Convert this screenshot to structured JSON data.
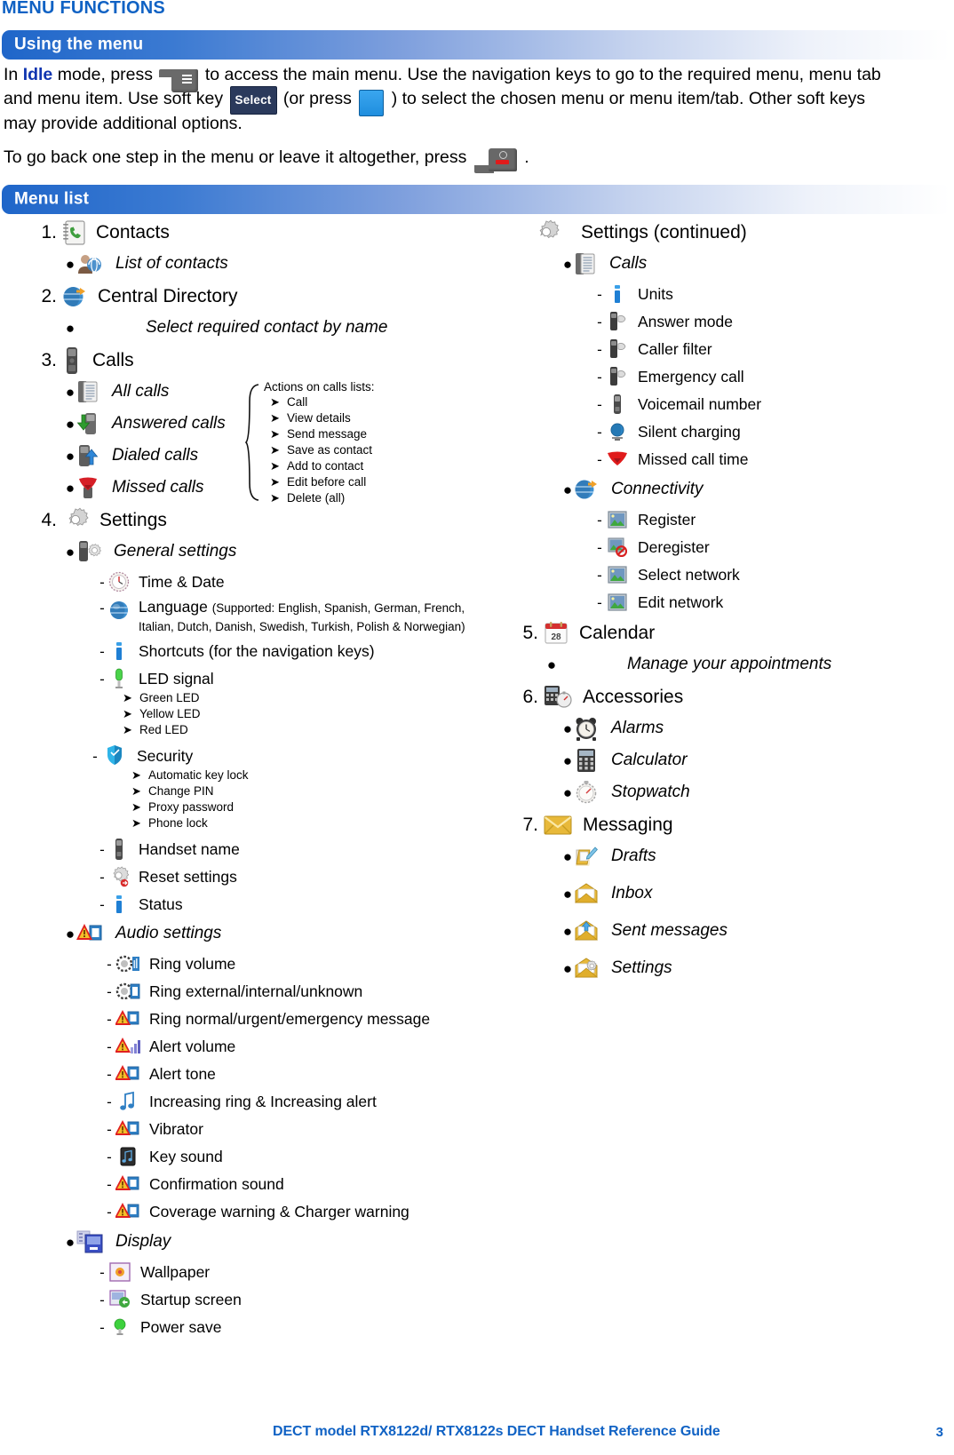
{
  "page": {
    "title": "MENU FUNCTIONS",
    "footer_text": "DECT model RTX8122d/ RTX8122s DECT Handset Reference Guide",
    "footer_page": "3"
  },
  "sections": {
    "using_the_menu": {
      "bar_label": "Using the menu",
      "paragraph1_a": "In ",
      "paragraph1_idle": "Idle",
      "paragraph1_b": " mode, press ",
      "paragraph1_c": " to access the main menu. Use the navigation keys to go to the required menu, menu tab and menu item. Use soft key ",
      "select_key": "Select",
      "paragraph1_d": " (or press ",
      "paragraph1_e": " ) to select the chosen menu or menu item/tab. Other soft keys may provide additional options.",
      "paragraph2_a": "To go back one step in the menu or leave it altogether, press ",
      "paragraph2_b": " ."
    },
    "menu_list": {
      "bar_label": "Menu list"
    }
  },
  "actions_box": {
    "title": "Actions on calls lists:",
    "items": [
      "Call",
      "View details",
      "Send message",
      "Save as contact",
      "Add to contact",
      "Edit before call",
      "Delete (all)"
    ]
  },
  "left_column": {
    "item1": {
      "num": "1.",
      "label": "Contacts",
      "icon": "contacts-book-icon"
    },
    "item1_sub1": {
      "label": "List of contacts",
      "icon": "person-contacts-icon"
    },
    "item2": {
      "num": "2.",
      "label": "Central Directory",
      "icon": "globe-directory-icon"
    },
    "item2_sub1": {
      "label": "Select required contact by name",
      "icon": "none"
    },
    "item3": {
      "num": "3.",
      "label": "Calls",
      "icon": "handset-icon"
    },
    "item3_sub1": {
      "label": "All calls",
      "icon": "call-list-icon"
    },
    "item3_sub2": {
      "label": "Answered calls",
      "icon": "answered-call-icon"
    },
    "item3_sub3": {
      "label": "Dialed calls",
      "icon": "dialed-call-icon"
    },
    "item3_sub4": {
      "label": "Missed calls",
      "icon": "missed-call-icon"
    },
    "item4": {
      "num": "4.",
      "label": "Settings",
      "icon": "gear-icon"
    },
    "general_settings": {
      "label": "General settings",
      "icon": "handset-gear-icon"
    },
    "time_date": {
      "label": "Time & Date",
      "icon": "clock-icon"
    },
    "language": {
      "label": "Language",
      "note": "(Supported: English, Spanish, German, French, Italian, Dutch, Danish, Swedish, Turkish, Polish & Norwegian)",
      "icon": "globe-icon"
    },
    "shortcuts": {
      "label": "Shortcuts (for the navigation keys)",
      "icon": "info-icon"
    },
    "led_signal": {
      "label": "LED signal",
      "icon": "led-icon",
      "items": [
        "Green LED",
        "Yellow LED",
        "Red LED"
      ]
    },
    "security": {
      "label": "Security",
      "icon": "shield-icon",
      "items": [
        "Automatic key lock",
        "Change PIN",
        "Proxy password",
        "Phone lock"
      ]
    },
    "handset_name": {
      "label": "Handset name",
      "icon": "handset-icon"
    },
    "reset_settings": {
      "label": "Reset settings",
      "icon": "gear-reset-icon"
    },
    "status": {
      "label": "Status",
      "icon": "info-icon"
    },
    "audio_settings": {
      "label": "Audio settings",
      "icon": "alert-speaker-icon"
    },
    "audio_items": [
      {
        "label": "Ring volume",
        "icon": "ring-volume-icon"
      },
      {
        "label": "Ring external/internal/unknown",
        "icon": "ring-source-icon"
      },
      {
        "label": "Ring normal/urgent/emergency message",
        "icon": "alert-speaker-icon"
      },
      {
        "label": "Alert volume",
        "icon": "alert-volume-icon"
      },
      {
        "label": "Alert tone",
        "icon": "alert-speaker-icon"
      },
      {
        "label": "Increasing ring & Increasing alert",
        "icon": "music-note-icon"
      },
      {
        "label": "Vibrator",
        "icon": "alert-speaker-icon"
      },
      {
        "label": "Key sound",
        "icon": "key-sound-icon"
      },
      {
        "label": "Confirmation sound",
        "icon": "alert-speaker-icon"
      },
      {
        "label": "Coverage warning & Charger warning",
        "icon": "alert-speaker-icon"
      }
    ],
    "display": {
      "label": "Display",
      "icon": "display-icon"
    },
    "display_items": [
      {
        "label": "Wallpaper",
        "icon": "wallpaper-icon"
      },
      {
        "label": "Startup screen",
        "icon": "startup-screen-icon"
      },
      {
        "label": "Power save",
        "icon": "power-save-icon"
      }
    ]
  },
  "right_column": {
    "settings_continued": {
      "label": "Settings (continued)",
      "icon": "gear-icon"
    },
    "calls": {
      "label": "Calls",
      "icon": "call-list-icon"
    },
    "calls_items": [
      {
        "label": "Units",
        "icon": "info-icon"
      },
      {
        "label": "Answer mode",
        "icon": "handset-answer-icon"
      },
      {
        "label": "Caller filter",
        "icon": "handset-answer-icon"
      },
      {
        "label": "Emergency call",
        "icon": "handset-answer-icon"
      },
      {
        "label": "Voicemail number",
        "icon": "handset-icon"
      },
      {
        "label": "Silent charging",
        "icon": "silent-charging-icon"
      },
      {
        "label": "Missed call time",
        "icon": "missed-call-arrow-icon"
      }
    ],
    "connectivity": {
      "label": "Connectivity",
      "icon": "globe-directory-icon"
    },
    "connectivity_items": [
      {
        "label": "Register",
        "icon": "network-icon"
      },
      {
        "label": "Deregister",
        "icon": "network-deregister-icon"
      },
      {
        "label": "Select network",
        "icon": "network-icon"
      },
      {
        "label": "Edit network",
        "icon": "network-icon"
      }
    ],
    "item5": {
      "num": "5.",
      "label": "Calendar",
      "icon": "calendar-icon",
      "calendar_day": "28"
    },
    "item5_sub1": {
      "label": "Manage your appointments",
      "icon": "none"
    },
    "item6": {
      "num": "6.",
      "label": "Accessories",
      "icon": "accessories-icon"
    },
    "accessories_items": [
      {
        "label": "Alarms",
        "icon": "alarm-clock-icon"
      },
      {
        "label": "Calculator",
        "icon": "calculator-icon"
      },
      {
        "label": "Stopwatch",
        "icon": "stopwatch-icon"
      }
    ],
    "item7": {
      "num": "7.",
      "label": "Messaging",
      "icon": "envelope-icon"
    },
    "messaging_items": [
      {
        "label": "Drafts",
        "icon": "draft-message-icon"
      },
      {
        "label": "Inbox",
        "icon": "inbox-icon"
      },
      {
        "label": "Sent messages",
        "icon": "sent-messages-icon"
      },
      {
        "label": "Settings",
        "icon": "message-settings-icon"
      }
    ]
  },
  "colors": {
    "brand_blue": "#1062c4",
    "bar_blue": "#1f66c9",
    "idle_blue": "#1035b0",
    "select_key_bg": "#2b3a5c"
  }
}
